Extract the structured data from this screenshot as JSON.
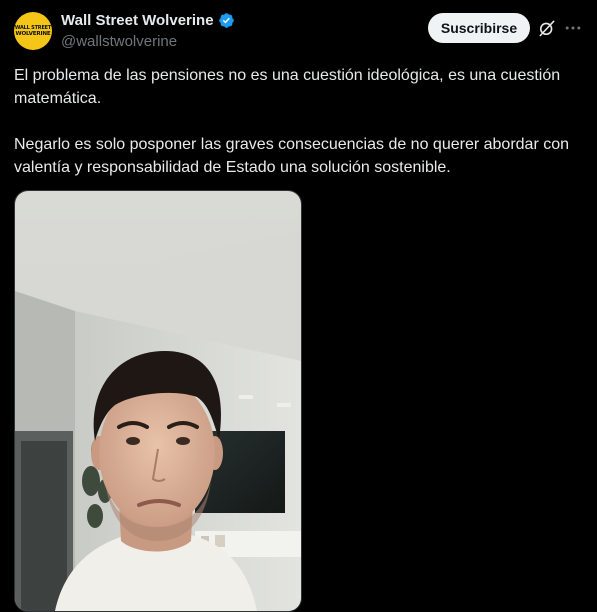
{
  "author": {
    "display_name": "Wall Street Wolverine",
    "handle": "@wallstwolverine",
    "avatar_text_line1": "WALL STREET",
    "avatar_text_line2": "WOLVERINE",
    "verified": true
  },
  "actions": {
    "subscribe_label": "Suscribirse",
    "grok_icon": "grok-icon",
    "more_icon": "more-icon"
  },
  "tweet": {
    "paragraphs": [
      "El problema de las pensiones no es una cuestión ideológica, es una cuestión matemática.",
      "Negarlo es solo posponer las graves consecuencias de no querer abordar con valentía y responsabilidad de Estado una solución sostenible."
    ]
  },
  "media": {
    "type": "video",
    "description_icon": "video-thumbnail"
  },
  "colors": {
    "background": "#000000",
    "text_primary": "#e7e9ea",
    "text_secondary": "#71767b",
    "verified_blue": "#1d9bf0",
    "button_bg": "#eff3f4",
    "avatar_bg": "#f5c518"
  }
}
